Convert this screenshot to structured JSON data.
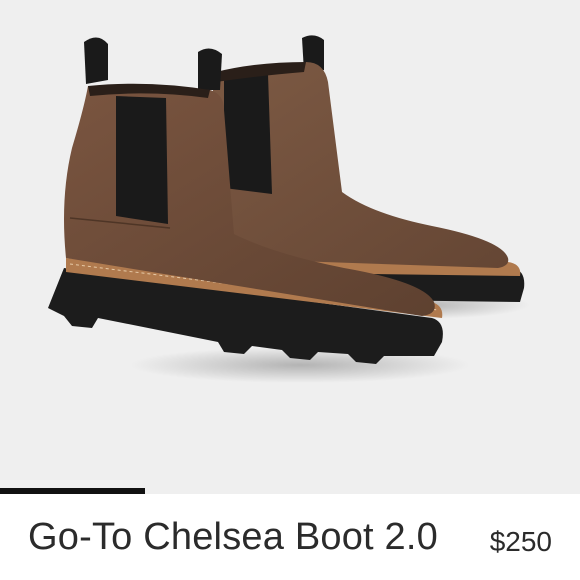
{
  "product": {
    "title": "Go-To Chelsea Boot 2.0",
    "price": "$250"
  },
  "gallery": {
    "progress": 0.25,
    "progress_color": "#111111",
    "image_subject": "pair of brown suede chelsea boots"
  },
  "colors": {
    "background": "#efefef",
    "suede": "#6b4a35",
    "elastic": "#1a1a1a",
    "welt": "#b07a4e",
    "sole": "#1c1c1c"
  }
}
